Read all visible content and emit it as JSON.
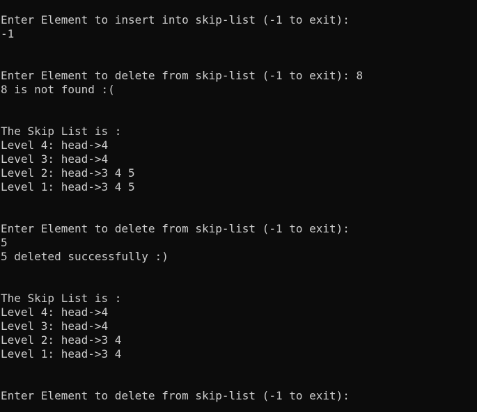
{
  "console": {
    "lines": [
      "Enter Element to insert into skip-list (-1 to exit):",
      "-1",
      "",
      "",
      "Enter Element to delete from skip-list (-1 to exit): 8",
      "8 is not found :(",
      "",
      "",
      "The Skip List is :",
      "Level 4: head->4",
      "Level 3: head->4",
      "Level 2: head->3 4 5",
      "Level 1: head->3 4 5",
      "",
      "",
      "Enter Element to delete from skip-list (-1 to exit):",
      "5",
      "5 deleted successfully :)",
      "",
      "",
      "The Skip List is :",
      "Level 4: head->4",
      "Level 3: head->4",
      "Level 2: head->3 4",
      "Level 1: head->3 4",
      "",
      "",
      "Enter Element to delete from skip-list (-1 to exit):"
    ]
  },
  "colors": {
    "background": "#0c0c0c",
    "text": "#cccccc"
  }
}
